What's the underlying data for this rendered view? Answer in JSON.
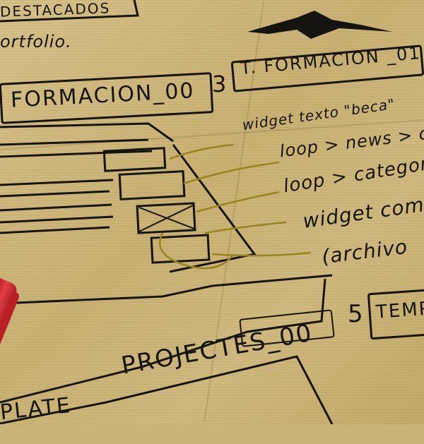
{
  "sketch": {
    "top_left_label": "DESTACADOS",
    "portfolio_text": "ortfolio.",
    "number_3": "3",
    "t_formacion_label": "T. FORMACION _01",
    "formacion_label": "FORMACION_00",
    "annotations": [
      "widget texto \"beca\"",
      "loop > news > cate",
      "loop > category",
      "widget com",
      "(archivo"
    ],
    "number_5": "5",
    "template_5_label": "TEMP",
    "projectes_label": "PROJECTES_00",
    "template_bottom_label": "PLATE"
  },
  "marker": {
    "cap_color": "#c8252b",
    "body_color": "#d9d9d9"
  },
  "colors": {
    "paper": "#cbb47a",
    "ink": "#161410",
    "gold_ink": "#9a8220"
  }
}
